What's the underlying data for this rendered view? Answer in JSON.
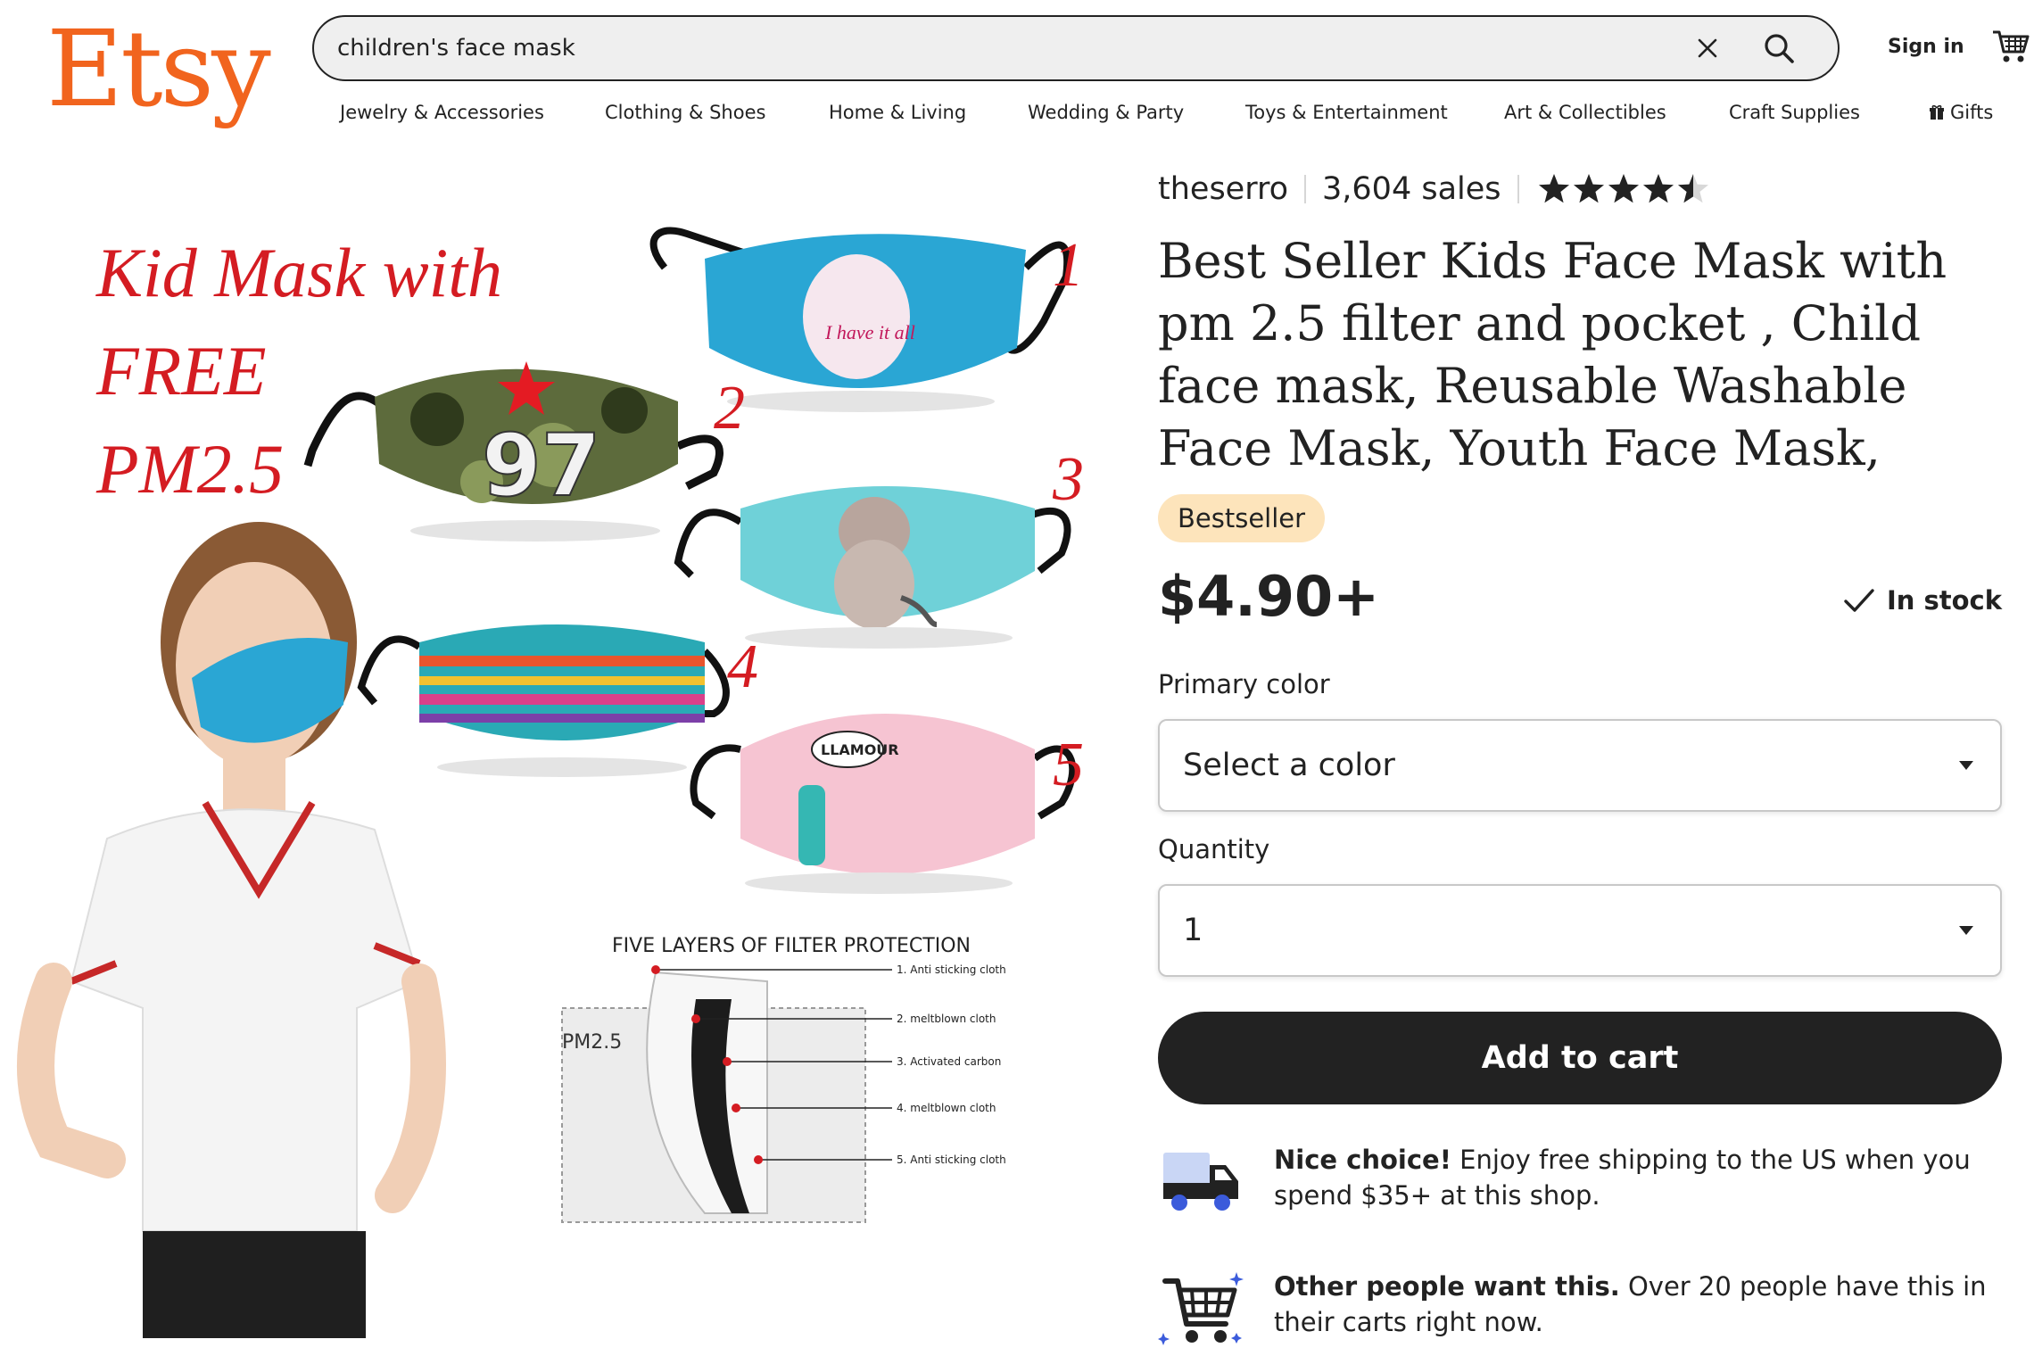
{
  "header": {
    "logo": "Etsy",
    "search_value": "children's face mask",
    "sign_in": "Sign in"
  },
  "nav": [
    "Jewelry & Accessories",
    "Clothing & Shoes",
    "Home & Living",
    "Wedding & Party",
    "Toys & Entertainment",
    "Art & Collectibles",
    "Craft Supplies",
    "Gifts"
  ],
  "product_image": {
    "heading_lines": [
      "Kid Mask with",
      "FREE",
      "PM2.5"
    ],
    "mask_numbers": [
      "1",
      "2",
      "3",
      "4",
      "5"
    ],
    "mask2_print": "97",
    "mask1_print": "I have it all",
    "mask5_print": "LLAMOUR",
    "filter_title": "FIVE LAYERS OF FILTER PROTECTION",
    "filter_label": "PM2.5",
    "filter_layers": [
      "1. Anti sticking cloth",
      "2. meltblown cloth",
      "3. Activated carbon",
      "4. meltblown cloth",
      "5. Anti sticking cloth"
    ]
  },
  "listing": {
    "shop_name": "theserro",
    "sales": "3,604 sales",
    "rating": 4.5,
    "title": "Best Seller Kids Face Mask with pm 2.5 filter and pocket , Child face mask, Reusable Washable Face Mask, Youth Face Mask,",
    "badge": "Bestseller",
    "price": "$4.90+",
    "stock": "In stock",
    "color_label": "Primary color",
    "color_value": "Select a color",
    "quantity_label": "Quantity",
    "quantity_value": "1",
    "add_to_cart": "Add to cart"
  },
  "promos": [
    {
      "icon": "delivery-truck-icon",
      "bold": "Nice choice!",
      "text": " Enjoy free shipping to the US when you spend $35+ at this shop."
    },
    {
      "icon": "shopping-cart-icon",
      "bold": "Other people want this.",
      "text": " Over 20 people have this in their carts right now."
    }
  ],
  "colors": {
    "brand": "#F1641E",
    "badge": "#FDE4BB",
    "button": "#222222",
    "truck_blue": "#3B5BDB"
  }
}
